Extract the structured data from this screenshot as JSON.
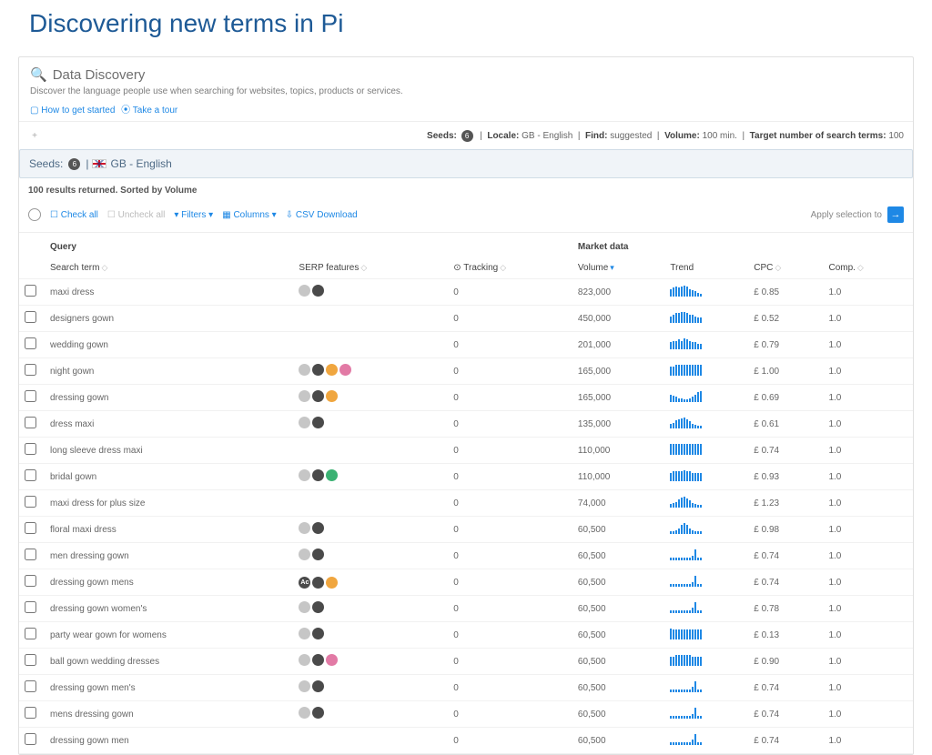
{
  "page_title": "Discovering new terms in Pi",
  "panel": {
    "title": "Data Discovery",
    "subtitle": "Discover the language people use when searching for websites, topics, products or services.",
    "links": {
      "how_to": "How to get started",
      "tour": "Take a tour"
    }
  },
  "statusbar": {
    "seeds_label": "Seeds:",
    "seeds_count": "6",
    "locale_label": "Locale:",
    "locale_value": "GB - English",
    "find_label": "Find:",
    "find_value": "suggested",
    "volume_label": "Volume:",
    "volume_value": "100 min.",
    "target_label": "Target number of search terms:",
    "target_value": "100"
  },
  "seedbar": {
    "prefix": "Seeds:",
    "count": "6",
    "locale": "GB - English"
  },
  "results_note": "100 results returned. Sorted by Volume",
  "toolbar": {
    "check_all": "Check all",
    "uncheck_all": "Uncheck all",
    "filters": "Filters",
    "columns": "Columns",
    "csv": "CSV Download",
    "apply": "Apply selection to"
  },
  "columns": {
    "group_query": "Query",
    "group_market": "Market data",
    "search_term": "Search term",
    "serp": "SERP features",
    "tracking": "Tracking",
    "volume": "Volume",
    "trend": "Trend",
    "cpc": "CPC",
    "comp": "Comp."
  },
  "rows": [
    {
      "term": "maxi dress",
      "features": [
        "gray",
        "dark"
      ],
      "tracking": 0,
      "volume": "823,000",
      "trend": [
        6,
        7,
        8,
        7,
        8,
        9,
        8,
        6,
        5,
        4,
        3,
        2
      ],
      "cpc": "£ 0.85",
      "comp": "1.0"
    },
    {
      "term": "designers gown",
      "features": [],
      "tracking": 0,
      "volume": "450,000",
      "trend": [
        4,
        5,
        6,
        6,
        7,
        7,
        6,
        5,
        5,
        4,
        3,
        3
      ],
      "cpc": "£ 0.52",
      "comp": "1.0"
    },
    {
      "term": "wedding gown",
      "features": [],
      "tracking": 0,
      "volume": "201,000",
      "trend": [
        5,
        6,
        6,
        7,
        6,
        8,
        7,
        6,
        5,
        5,
        4,
        4
      ],
      "cpc": "£ 0.79",
      "comp": "1.0"
    },
    {
      "term": "night gown",
      "features": [
        "gray",
        "dark",
        "orange",
        "pink"
      ],
      "tracking": 0,
      "volume": "165,000",
      "trend": [
        5,
        5,
        6,
        6,
        6,
        6,
        6,
        6,
        6,
        6,
        6,
        6
      ],
      "cpc": "£ 1.00",
      "comp": "1.0"
    },
    {
      "term": "dressing gown",
      "features": [
        "gray",
        "dark",
        "orange"
      ],
      "tracking": 0,
      "volume": "165,000",
      "trend": [
        6,
        5,
        4,
        3,
        3,
        2,
        2,
        3,
        4,
        6,
        8,
        9
      ],
      "cpc": "£ 0.69",
      "comp": "1.0"
    },
    {
      "term": "dress maxi",
      "features": [
        "gray",
        "dark"
      ],
      "tracking": 0,
      "volume": "135,000",
      "trend": [
        4,
        5,
        7,
        8,
        9,
        10,
        8,
        6,
        4,
        3,
        2,
        2
      ],
      "cpc": "£ 0.61",
      "comp": "1.0"
    },
    {
      "term": "long sleeve dress maxi",
      "features": [],
      "tracking": 0,
      "volume": "110,000",
      "trend": [
        6,
        6,
        6,
        6,
        6,
        6,
        6,
        6,
        6,
        6,
        6,
        6
      ],
      "cpc": "£ 0.74",
      "comp": "1.0"
    },
    {
      "term": "bridal gown",
      "features": [
        "gray",
        "dark",
        "green"
      ],
      "tracking": 0,
      "volume": "110,000",
      "trend": [
        5,
        6,
        6,
        6,
        6,
        7,
        6,
        6,
        5,
        5,
        5,
        5
      ],
      "cpc": "£ 0.93",
      "comp": "1.0"
    },
    {
      "term": "maxi dress for plus size",
      "features": [],
      "tracking": 0,
      "volume": "74,000",
      "trend": [
        3,
        4,
        5,
        7,
        9,
        10,
        8,
        6,
        4,
        3,
        2,
        2
      ],
      "cpc": "£ 1.23",
      "comp": "1.0"
    },
    {
      "term": "floral maxi dress",
      "features": [
        "gray",
        "dark"
      ],
      "tracking": 0,
      "volume": "60,500",
      "trend": [
        2,
        2,
        3,
        5,
        8,
        10,
        8,
        5,
        3,
        2,
        2,
        2
      ],
      "cpc": "£ 0.98",
      "comp": "1.0"
    },
    {
      "term": "men dressing gown",
      "features": [
        "gray",
        "dark"
      ],
      "tracking": 0,
      "volume": "60,500",
      "trend": [
        1,
        1,
        1,
        1,
        1,
        1,
        1,
        1,
        2,
        5,
        1,
        1
      ],
      "cpc": "£ 0.74",
      "comp": "1.0"
    },
    {
      "term": "dressing gown mens",
      "features": [
        "darkAA",
        "dark",
        "orange"
      ],
      "tracking": 0,
      "volume": "60,500",
      "trend": [
        1,
        1,
        1,
        1,
        1,
        1,
        1,
        1,
        2,
        5,
        1,
        1
      ],
      "cpc": "£ 0.74",
      "comp": "1.0"
    },
    {
      "term": "dressing gown women's",
      "features": [
        "gray",
        "dark"
      ],
      "tracking": 0,
      "volume": "60,500",
      "trend": [
        1,
        1,
        1,
        1,
        1,
        1,
        1,
        1,
        2,
        4,
        1,
        1
      ],
      "cpc": "£ 0.78",
      "comp": "1.0"
    },
    {
      "term": "party wear gown for womens",
      "features": [
        "gray",
        "dark"
      ],
      "tracking": 0,
      "volume": "60,500",
      "trend": [
        7,
        6,
        6,
        6,
        6,
        6,
        6,
        6,
        6,
        6,
        6,
        6
      ],
      "cpc": "£ 0.13",
      "comp": "1.0"
    },
    {
      "term": "ball gown wedding dresses",
      "features": [
        "gray",
        "dark",
        "pink"
      ],
      "tracking": 0,
      "volume": "60,500",
      "trend": [
        5,
        5,
        6,
        6,
        6,
        6,
        6,
        6,
        5,
        5,
        5,
        5
      ],
      "cpc": "£ 0.90",
      "comp": "1.0"
    },
    {
      "term": "dressing gown men's",
      "features": [
        "gray",
        "dark"
      ],
      "tracking": 0,
      "volume": "60,500",
      "trend": [
        1,
        1,
        1,
        1,
        1,
        1,
        1,
        1,
        2,
        4,
        1,
        1
      ],
      "cpc": "£ 0.74",
      "comp": "1.0"
    },
    {
      "term": "mens dressing gown",
      "features": [
        "gray",
        "dark"
      ],
      "tracking": 0,
      "volume": "60,500",
      "trend": [
        1,
        1,
        1,
        1,
        1,
        1,
        1,
        1,
        2,
        5,
        1,
        1
      ],
      "cpc": "£ 0.74",
      "comp": "1.0"
    },
    {
      "term": "dressing gown men",
      "features": [],
      "tracking": 0,
      "volume": "60,500",
      "trend": [
        1,
        1,
        1,
        1,
        1,
        1,
        1,
        1,
        2,
        4,
        1,
        1
      ],
      "cpc": "£ 0.74",
      "comp": "1.0"
    }
  ]
}
